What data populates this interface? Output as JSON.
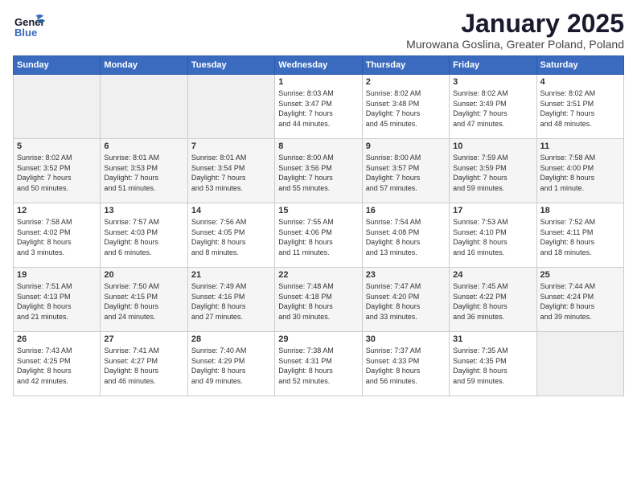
{
  "header": {
    "logo_general": "General",
    "logo_blue": "Blue",
    "month_title": "January 2025",
    "subtitle": "Murowana Goslina, Greater Poland, Poland"
  },
  "days_of_week": [
    "Sunday",
    "Monday",
    "Tuesday",
    "Wednesday",
    "Thursday",
    "Friday",
    "Saturday"
  ],
  "weeks": [
    [
      {
        "day": "",
        "content": ""
      },
      {
        "day": "",
        "content": ""
      },
      {
        "day": "",
        "content": ""
      },
      {
        "day": "1",
        "content": "Sunrise: 8:03 AM\nSunset: 3:47 PM\nDaylight: 7 hours\nand 44 minutes."
      },
      {
        "day": "2",
        "content": "Sunrise: 8:02 AM\nSunset: 3:48 PM\nDaylight: 7 hours\nand 45 minutes."
      },
      {
        "day": "3",
        "content": "Sunrise: 8:02 AM\nSunset: 3:49 PM\nDaylight: 7 hours\nand 47 minutes."
      },
      {
        "day": "4",
        "content": "Sunrise: 8:02 AM\nSunset: 3:51 PM\nDaylight: 7 hours\nand 48 minutes."
      }
    ],
    [
      {
        "day": "5",
        "content": "Sunrise: 8:02 AM\nSunset: 3:52 PM\nDaylight: 7 hours\nand 50 minutes."
      },
      {
        "day": "6",
        "content": "Sunrise: 8:01 AM\nSunset: 3:53 PM\nDaylight: 7 hours\nand 51 minutes."
      },
      {
        "day": "7",
        "content": "Sunrise: 8:01 AM\nSunset: 3:54 PM\nDaylight: 7 hours\nand 53 minutes."
      },
      {
        "day": "8",
        "content": "Sunrise: 8:00 AM\nSunset: 3:56 PM\nDaylight: 7 hours\nand 55 minutes."
      },
      {
        "day": "9",
        "content": "Sunrise: 8:00 AM\nSunset: 3:57 PM\nDaylight: 7 hours\nand 57 minutes."
      },
      {
        "day": "10",
        "content": "Sunrise: 7:59 AM\nSunset: 3:59 PM\nDaylight: 7 hours\nand 59 minutes."
      },
      {
        "day": "11",
        "content": "Sunrise: 7:58 AM\nSunset: 4:00 PM\nDaylight: 8 hours\nand 1 minute."
      }
    ],
    [
      {
        "day": "12",
        "content": "Sunrise: 7:58 AM\nSunset: 4:02 PM\nDaylight: 8 hours\nand 3 minutes."
      },
      {
        "day": "13",
        "content": "Sunrise: 7:57 AM\nSunset: 4:03 PM\nDaylight: 8 hours\nand 6 minutes."
      },
      {
        "day": "14",
        "content": "Sunrise: 7:56 AM\nSunset: 4:05 PM\nDaylight: 8 hours\nand 8 minutes."
      },
      {
        "day": "15",
        "content": "Sunrise: 7:55 AM\nSunset: 4:06 PM\nDaylight: 8 hours\nand 11 minutes."
      },
      {
        "day": "16",
        "content": "Sunrise: 7:54 AM\nSunset: 4:08 PM\nDaylight: 8 hours\nand 13 minutes."
      },
      {
        "day": "17",
        "content": "Sunrise: 7:53 AM\nSunset: 4:10 PM\nDaylight: 8 hours\nand 16 minutes."
      },
      {
        "day": "18",
        "content": "Sunrise: 7:52 AM\nSunset: 4:11 PM\nDaylight: 8 hours\nand 18 minutes."
      }
    ],
    [
      {
        "day": "19",
        "content": "Sunrise: 7:51 AM\nSunset: 4:13 PM\nDaylight: 8 hours\nand 21 minutes."
      },
      {
        "day": "20",
        "content": "Sunrise: 7:50 AM\nSunset: 4:15 PM\nDaylight: 8 hours\nand 24 minutes."
      },
      {
        "day": "21",
        "content": "Sunrise: 7:49 AM\nSunset: 4:16 PM\nDaylight: 8 hours\nand 27 minutes."
      },
      {
        "day": "22",
        "content": "Sunrise: 7:48 AM\nSunset: 4:18 PM\nDaylight: 8 hours\nand 30 minutes."
      },
      {
        "day": "23",
        "content": "Sunrise: 7:47 AM\nSunset: 4:20 PM\nDaylight: 8 hours\nand 33 minutes."
      },
      {
        "day": "24",
        "content": "Sunrise: 7:45 AM\nSunset: 4:22 PM\nDaylight: 8 hours\nand 36 minutes."
      },
      {
        "day": "25",
        "content": "Sunrise: 7:44 AM\nSunset: 4:24 PM\nDaylight: 8 hours\nand 39 minutes."
      }
    ],
    [
      {
        "day": "26",
        "content": "Sunrise: 7:43 AM\nSunset: 4:25 PM\nDaylight: 8 hours\nand 42 minutes."
      },
      {
        "day": "27",
        "content": "Sunrise: 7:41 AM\nSunset: 4:27 PM\nDaylight: 8 hours\nand 46 minutes."
      },
      {
        "day": "28",
        "content": "Sunrise: 7:40 AM\nSunset: 4:29 PM\nDaylight: 8 hours\nand 49 minutes."
      },
      {
        "day": "29",
        "content": "Sunrise: 7:38 AM\nSunset: 4:31 PM\nDaylight: 8 hours\nand 52 minutes."
      },
      {
        "day": "30",
        "content": "Sunrise: 7:37 AM\nSunset: 4:33 PM\nDaylight: 8 hours\nand 56 minutes."
      },
      {
        "day": "31",
        "content": "Sunrise: 7:35 AM\nSunset: 4:35 PM\nDaylight: 8 hours\nand 59 minutes."
      },
      {
        "day": "",
        "content": ""
      }
    ]
  ]
}
